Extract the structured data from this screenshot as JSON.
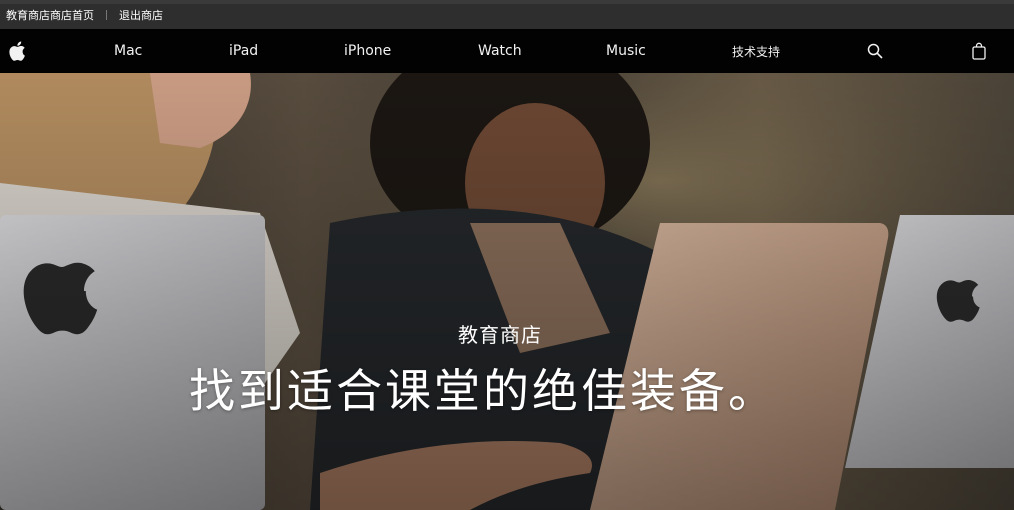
{
  "edu_bar": {
    "home_label": "教育商店商店首页",
    "exit_label": "退出商店"
  },
  "nav": {
    "logo_icon": "apple-logo-icon",
    "items": [
      {
        "label": "Mac"
      },
      {
        "label": "iPad"
      },
      {
        "label": "iPhone"
      },
      {
        "label": "Watch"
      },
      {
        "label": "Music"
      },
      {
        "label": "技术支持"
      }
    ],
    "search_icon": "search-icon",
    "bag_icon": "shopping-bag-icon"
  },
  "hero": {
    "eyebrow": "教育商店",
    "headline": "找到适合课堂的绝佳装备。"
  },
  "colors": {
    "nav_bg": "#0a0a0a",
    "edu_bar_bg": "#2e2e2e",
    "text": "#ffffff"
  }
}
